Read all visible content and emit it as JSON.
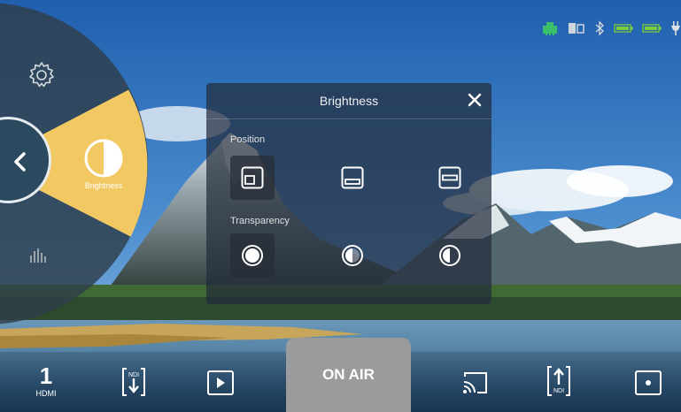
{
  "status_bar": {
    "icons": [
      "ethernet-icon",
      "sd-card-icon",
      "bluetooth-icon",
      "battery-1-icon",
      "battery-2-icon",
      "power-plug-icon"
    ],
    "colors": {
      "ethernet": "#3bbf6a",
      "battery": "#7ccc3a"
    }
  },
  "radial_menu": {
    "items": [
      {
        "icon": "gear-icon"
      },
      {
        "icon": "brightness-icon",
        "label": "Brightness",
        "selected": true
      },
      {
        "icon": "audio-levels-icon"
      }
    ],
    "back_icon": "chevron-left-icon",
    "accent": "#f2c862"
  },
  "brightness_panel": {
    "title": "Brightness",
    "close_icon": "close-icon",
    "position_label": "Position",
    "transparency_label": "Transparency",
    "position_options": [
      {
        "icon": "position-small-icon",
        "selected": true
      },
      {
        "icon": "position-bottom-icon",
        "selected": false
      },
      {
        "icon": "position-center-icon",
        "selected": false
      }
    ],
    "transparency_options": [
      {
        "icon": "opacity-full-icon",
        "selected": true
      },
      {
        "icon": "opacity-half-icon",
        "selected": false
      },
      {
        "icon": "opacity-low-icon",
        "selected": false
      }
    ]
  },
  "bottom_bar": {
    "input_number": "1",
    "input_label": "HDMI",
    "on_air_label": "ON AIR",
    "items": [
      "ndi-in-icon",
      "play-icon",
      "cast-icon",
      "ndi-out-icon",
      "record-icon"
    ],
    "ndi_label": "NDI"
  }
}
